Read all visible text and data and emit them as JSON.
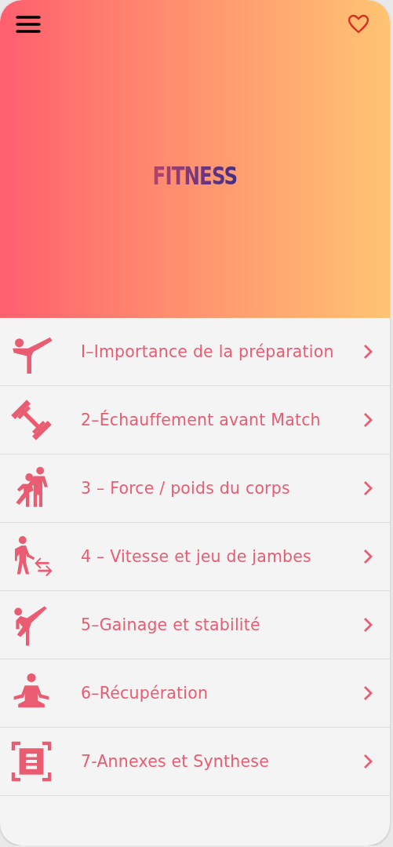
{
  "header": {
    "title": "FITNESS"
  },
  "items": [
    {
      "label": "I–Importance de la préparation"
    },
    {
      "label": "2–Échauffement avant Match"
    },
    {
      "label": "3 – Force / poids du corps"
    },
    {
      "label": "4 – Vitesse et jeu de jambes"
    },
    {
      "label": "5–Gainage et stabilité"
    },
    {
      "label": "6–Récupération"
    },
    {
      "label": "7-Annexes et Synthese"
    }
  ]
}
